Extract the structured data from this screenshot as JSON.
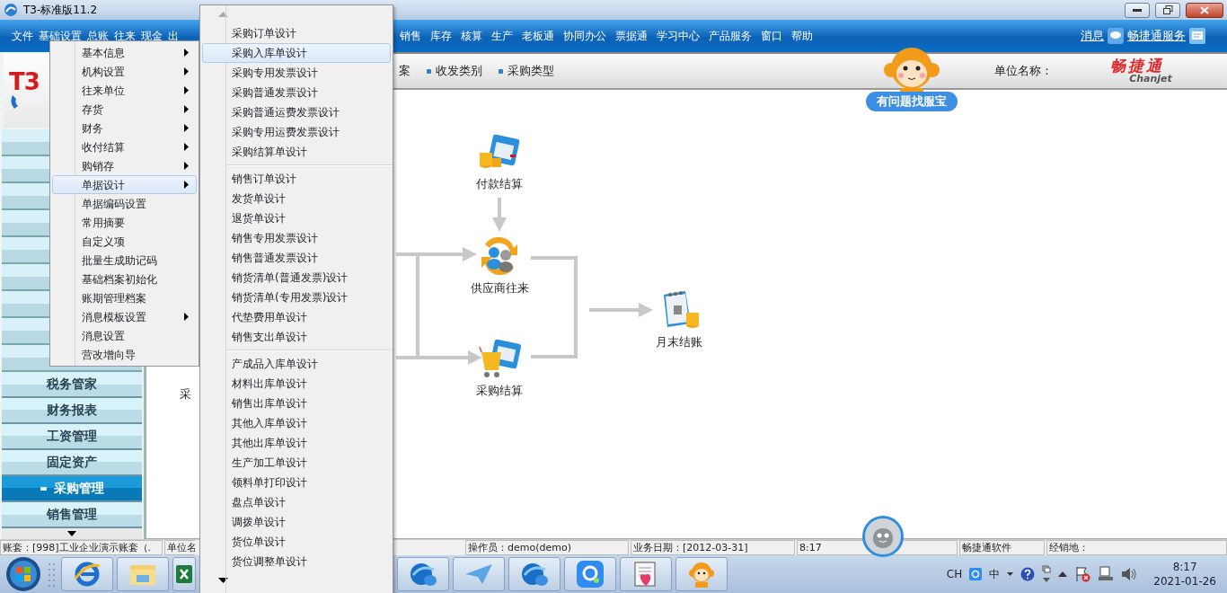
{
  "window": {
    "title": "T3-标准版11.2"
  },
  "menubar": {
    "items": [
      "文件",
      "基础设置",
      "总账",
      "往来",
      "现金",
      "出"
    ],
    "items_right": [
      "销售",
      "库存",
      "核算",
      "生产",
      "老板通",
      "协同办公",
      "票据通",
      "学习中心",
      "产品服务",
      "窗口",
      "帮助"
    ],
    "links": [
      "消息",
      "畅捷通服务"
    ]
  },
  "toolbar": {
    "items": [
      {
        "label": "案",
        "bullet": false
      },
      {
        "label": "收发类别",
        "bullet": true
      },
      {
        "label": "采购类型",
        "bullet": true
      }
    ],
    "help_badge": "有问题找服宝",
    "unit_label": "单位名称：",
    "logo": "畅捷通",
    "logo_sub": "Chanjet"
  },
  "sidebar": {
    "logo": "T3",
    "items": [
      {
        "label": "税务管家",
        "selected": false
      },
      {
        "label": "财务报表",
        "selected": false
      },
      {
        "label": "工资管理",
        "selected": false
      },
      {
        "label": "固定资产",
        "selected": false
      },
      {
        "label": "采购管理",
        "selected": true
      },
      {
        "label": "销售管理",
        "selected": false
      }
    ]
  },
  "diagram": {
    "nodes": [
      {
        "label": "采",
        "kind": "partial"
      },
      {
        "label": "付款结算",
        "kind": "payment"
      },
      {
        "label": "供应商往来",
        "kind": "supplier"
      },
      {
        "label": "采购结算",
        "kind": "purchase"
      },
      {
        "label": "月末结账",
        "kind": "close"
      }
    ]
  },
  "menu": {
    "items": [
      {
        "label": "基本信息",
        "submenu": true,
        "selected": false
      },
      {
        "label": "机构设置",
        "submenu": true,
        "selected": false
      },
      {
        "label": "往来单位",
        "submenu": true,
        "selected": false
      },
      {
        "label": "存货",
        "submenu": true,
        "selected": false
      },
      {
        "label": "财务",
        "submenu": true,
        "selected": false
      },
      {
        "label": "收付结算",
        "submenu": true,
        "selected": false
      },
      {
        "label": "购销存",
        "submenu": true,
        "selected": false
      },
      {
        "label": "单据设计",
        "submenu": true,
        "selected": true
      },
      {
        "label": "单据编码设置",
        "submenu": false,
        "selected": false
      },
      {
        "label": "常用摘要",
        "submenu": false,
        "selected": false
      },
      {
        "label": "自定义项",
        "submenu": false,
        "selected": false
      },
      {
        "label": "批量生成助记码",
        "submenu": false,
        "selected": false
      },
      {
        "label": "基础档案初始化",
        "submenu": false,
        "selected": false
      },
      {
        "label": "账期管理档案",
        "submenu": false,
        "selected": false
      },
      {
        "label": "消息模板设置",
        "submenu": true,
        "selected": false
      },
      {
        "label": "消息设置",
        "submenu": false,
        "selected": false
      },
      {
        "label": "营改增向导",
        "submenu": false,
        "selected": false
      }
    ]
  },
  "submenu": {
    "groups": [
      [
        {
          "label": "采购订单设计",
          "selected": false
        },
        {
          "label": "采购入库单设计",
          "selected": true
        },
        {
          "label": "采购专用发票设计",
          "selected": false
        },
        {
          "label": "采购普通发票设计",
          "selected": false
        },
        {
          "label": "采购普通运费发票设计",
          "selected": false
        },
        {
          "label": "采购专用运费发票设计",
          "selected": false
        },
        {
          "label": "采购结算单设计",
          "selected": false
        }
      ],
      [
        {
          "label": "销售订单设计",
          "selected": false
        },
        {
          "label": "发货单设计",
          "selected": false
        },
        {
          "label": "退货单设计",
          "selected": false
        },
        {
          "label": "销售专用发票设计",
          "selected": false
        },
        {
          "label": "销售普通发票设计",
          "selected": false
        },
        {
          "label": "销货清单(普通发票)设计",
          "selected": false
        },
        {
          "label": "销货清单(专用发票)设计",
          "selected": false
        },
        {
          "label": "代垫费用单设计",
          "selected": false
        },
        {
          "label": "销售支出单设计",
          "selected": false
        }
      ],
      [
        {
          "label": "产成品入库单设计",
          "selected": false
        },
        {
          "label": "材料出库单设计",
          "selected": false
        },
        {
          "label": "销售出库单设计",
          "selected": false
        },
        {
          "label": "其他入库单设计",
          "selected": false
        },
        {
          "label": "其他出库单设计",
          "selected": false
        },
        {
          "label": "生产加工单设计",
          "selected": false
        },
        {
          "label": "领料单打印设计",
          "selected": false
        },
        {
          "label": "盘点单设计",
          "selected": false
        },
        {
          "label": "调拨单设计",
          "selected": false
        },
        {
          "label": "货位单设计",
          "selected": false
        },
        {
          "label": "货位调整单设计",
          "selected": false
        }
      ]
    ]
  },
  "status_bar": {
    "fields": [
      "账套：[998]工业企业演示账套（.",
      "单位名",
      "操作员：demo(demo)",
      "业务日期：[2012-03-31]",
      "8:17",
      "畅捷通软件",
      "经销地："
    ]
  },
  "taskbar": {
    "tray": {
      "input": "CH",
      "ime": "中",
      "time": "8:17",
      "date": "2021-01-26"
    }
  }
}
